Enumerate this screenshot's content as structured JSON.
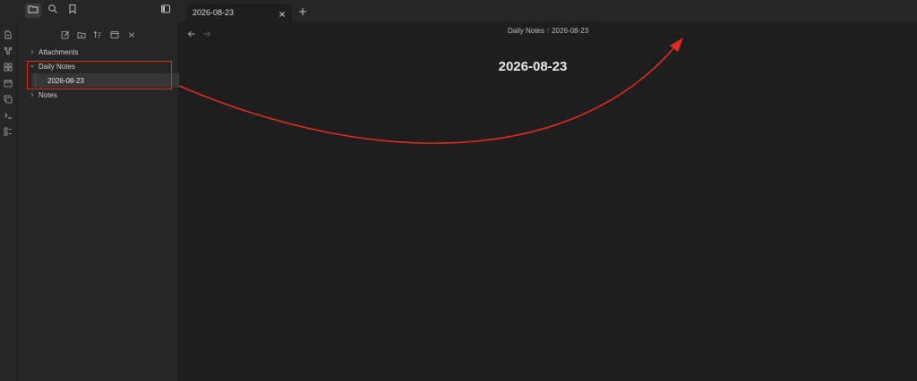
{
  "tab": {
    "title": "2026-08-23"
  },
  "sidebar": {
    "tree": [
      {
        "label": "Attachments",
        "expanded": false
      },
      {
        "label": "Daily Notes",
        "expanded": true,
        "children": [
          {
            "label": "2026-08-23",
            "selected": true
          }
        ]
      },
      {
        "label": "Notes",
        "expanded": false
      }
    ]
  },
  "breadcrumb": {
    "folder": "Daily Notes",
    "separator": "/",
    "file": "2026-08-23"
  },
  "note": {
    "title": "2026-08-23"
  },
  "colors": {
    "annotation": "#e02a1f",
    "background": "#1e1e1e",
    "sidebar": "#262626"
  },
  "icons": {
    "topbar": [
      "folder-icon",
      "search-icon",
      "bookmark-icon",
      "sidebar-toggle-icon",
      "close-icon",
      "plus-icon"
    ],
    "ribbon": [
      "file-icon",
      "graph-icon",
      "canvas-icon",
      "calendar-icon",
      "copy-icon",
      "terminal-icon",
      "command-icon"
    ],
    "sidebar_tools": [
      "new-note-icon",
      "new-folder-icon",
      "sort-icon",
      "collapse-icon",
      "close-icon"
    ]
  }
}
